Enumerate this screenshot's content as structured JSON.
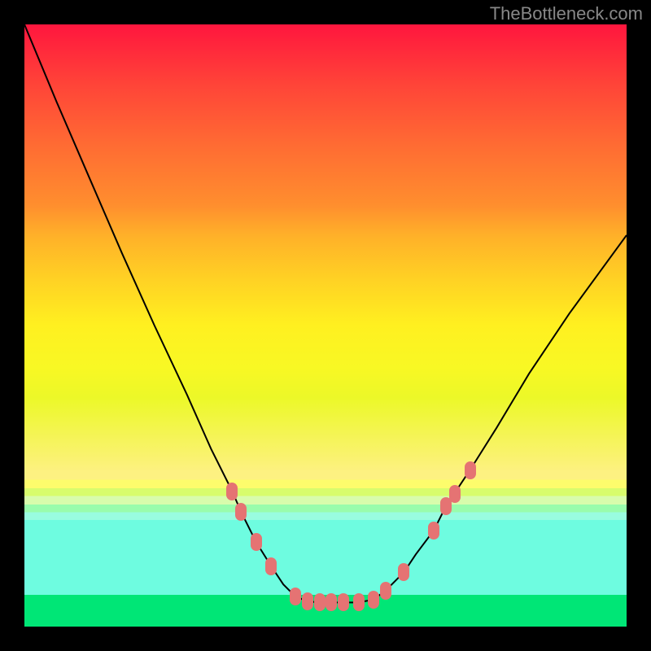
{
  "watermark": "TheBottleneck.com",
  "chart_data": {
    "type": "line",
    "title": "",
    "xlabel": "",
    "ylabel": "",
    "xlim": [
      0,
      100
    ],
    "ylim": [
      0,
      100
    ],
    "curve": [
      {
        "x": 0.0,
        "y": 100.0
      },
      {
        "x": 5.4,
        "y": 87.0
      },
      {
        "x": 10.8,
        "y": 74.5
      },
      {
        "x": 16.2,
        "y": 62.0
      },
      {
        "x": 21.6,
        "y": 50.0
      },
      {
        "x": 27.0,
        "y": 38.5
      },
      {
        "x": 31.0,
        "y": 29.5
      },
      {
        "x": 34.5,
        "y": 22.5
      },
      {
        "x": 36.0,
        "y": 19.0
      },
      {
        "x": 38.5,
        "y": 14.0
      },
      {
        "x": 41.0,
        "y": 10.0
      },
      {
        "x": 43.0,
        "y": 7.0
      },
      {
        "x": 45.0,
        "y": 5.0
      },
      {
        "x": 47.0,
        "y": 4.2
      },
      {
        "x": 49.0,
        "y": 4.0
      },
      {
        "x": 51.0,
        "y": 4.0
      },
      {
        "x": 53.0,
        "y": 4.0
      },
      {
        "x": 55.5,
        "y": 4.0
      },
      {
        "x": 58.0,
        "y": 4.5
      },
      {
        "x": 60.0,
        "y": 6.0
      },
      {
        "x": 63.0,
        "y": 9.0
      },
      {
        "x": 65.0,
        "y": 12.0
      },
      {
        "x": 68.0,
        "y": 16.0
      },
      {
        "x": 70.0,
        "y": 20.0
      },
      {
        "x": 74.0,
        "y": 26.0
      },
      {
        "x": 78.4,
        "y": 33.0
      },
      {
        "x": 83.8,
        "y": 42.0
      },
      {
        "x": 90.5,
        "y": 52.0
      },
      {
        "x": 100.0,
        "y": 65.0
      }
    ],
    "markers": [
      {
        "x": 34.5,
        "y": 22.5
      },
      {
        "x": 36.0,
        "y": 19.0
      },
      {
        "x": 38.5,
        "y": 14.0
      },
      {
        "x": 41.0,
        "y": 10.0
      },
      {
        "x": 45.0,
        "y": 5.0
      },
      {
        "x": 47.0,
        "y": 4.2
      },
      {
        "x": 49.0,
        "y": 4.0
      },
      {
        "x": 51.0,
        "y": 4.0
      },
      {
        "x": 53.0,
        "y": 4.0
      },
      {
        "x": 55.5,
        "y": 4.0
      },
      {
        "x": 58.0,
        "y": 4.5
      },
      {
        "x": 60.0,
        "y": 6.0
      },
      {
        "x": 63.0,
        "y": 9.0
      },
      {
        "x": 68.0,
        "y": 16.0
      },
      {
        "x": 70.0,
        "y": 20.0
      },
      {
        "x": 71.5,
        "y": 22.0
      },
      {
        "x": 74.0,
        "y": 26.0
      }
    ],
    "gradient_bands": [
      {
        "from": 0,
        "to": 74.3,
        "type": "smooth"
      },
      {
        "from": 74.3,
        "to": 94.7,
        "type": "striped"
      },
      {
        "from": 94.7,
        "to": 100,
        "type": "solid-green"
      }
    ]
  }
}
